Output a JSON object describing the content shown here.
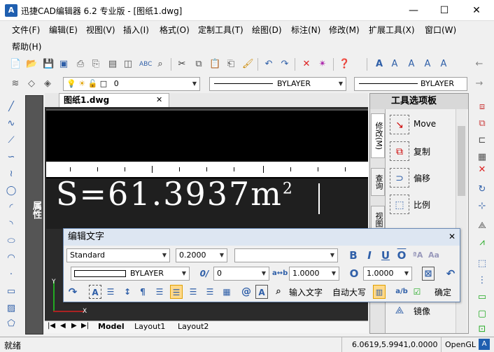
{
  "window": {
    "title": "迅捷CAD编辑器 6.2 专业版  - [图纸1.dwg]",
    "logo": "A",
    "minimize": "—",
    "maximize": "☐",
    "close": "✕"
  },
  "menu": [
    "文件(F)",
    "编辑(E)",
    "视图(V)",
    "插入(I)",
    "格式(O)",
    "定制工具(T)",
    "绘图(D)",
    "标注(N)",
    "修改(M)",
    "扩展工具(X)",
    "窗口(W)",
    "帮助(H)"
  ],
  "toolbar2": {
    "layer_value": "0",
    "linetype_value": "BYLAYER",
    "lineweight_value": "BYLAYER"
  },
  "document": {
    "tab_label": "图纸1.dwg",
    "tab_close": "✕",
    "big_text": "S=61.3937m",
    "superscript": "2",
    "ucs_y": "Y",
    "ucs_x": "X"
  },
  "properties_panel": {
    "label": "属性"
  },
  "layouts": [
    "Model",
    "Layout1",
    "Layout2"
  ],
  "tool_palette": {
    "title": "工具选项板",
    "tabs": [
      "修改(M)",
      "查询",
      "视图"
    ],
    "items": [
      {
        "label": "Move",
        "icon": "move-icon"
      },
      {
        "label": "复制",
        "icon": "copy-icon"
      },
      {
        "label": "偏移",
        "icon": "offset-icon"
      },
      {
        "label": "比例",
        "icon": "scale-icon"
      },
      {
        "label": "镜像",
        "icon": "mirror-icon"
      }
    ]
  },
  "text_editor": {
    "title": "编辑文字",
    "close": "✕",
    "style_value": "Standard",
    "height_value": "0.2000",
    "font_value": "",
    "color_value": "BYLAYER",
    "oblique_symbol": "0/",
    "oblique_value": "0",
    "tracking_symbol": "a↔b",
    "tracking_value": "1.0000",
    "width_symbol": "O",
    "width_value": "1.0000",
    "bold": "B",
    "italic": "I",
    "underline": "U",
    "overline": "O",
    "input_text_label": "输入文字",
    "auto_caps_label": "自动大写",
    "ok_label": "确定"
  },
  "status": {
    "ready": "就绪",
    "coords": "6.0619,5.9941,0.0000",
    "renderer": "OpenGL"
  },
  "colors": {
    "accent": "#2f5fa8",
    "canvas": "#2b2b2b",
    "dialog_title": "#dde6f2"
  }
}
